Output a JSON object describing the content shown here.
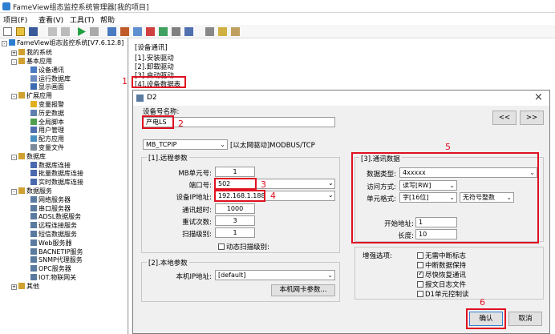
{
  "window": {
    "title": "FameView组态监控系统管理器[我的项目]"
  },
  "menu": [
    "项目(F)",
    "查看(V)",
    "工具(T)",
    "帮助"
  ],
  "tree": [
    {
      "label": "FameView组态监控系统[V7.6.12.8]",
      "level": 0,
      "expander": "-"
    },
    {
      "label": "我的系统",
      "level": 1,
      "expander": "+"
    },
    {
      "label": "基本应用",
      "level": 1,
      "expander": "-"
    },
    {
      "label": "设备通讯",
      "level": 2
    },
    {
      "label": "运行数据库",
      "level": 2
    },
    {
      "label": "显示画面",
      "level": 2
    },
    {
      "label": "扩展应用",
      "level": 1,
      "expander": "-"
    },
    {
      "label": "变量报警",
      "level": 2
    },
    {
      "label": "历史数据",
      "level": 2
    },
    {
      "label": "全局脚本",
      "level": 2
    },
    {
      "label": "用户管理",
      "level": 2
    },
    {
      "label": "配方应用",
      "level": 2
    },
    {
      "label": "变量文件",
      "level": 2
    },
    {
      "label": "数据库",
      "level": 1,
      "expander": "-"
    },
    {
      "label": "数据库连接",
      "level": 2
    },
    {
      "label": "批量数据库连接",
      "level": 2
    },
    {
      "label": "实时数据库连接",
      "level": 2
    },
    {
      "label": "数据服务",
      "level": 1,
      "expander": "-"
    },
    {
      "label": "网络服务器",
      "level": 2
    },
    {
      "label": "串口服务器",
      "level": 2
    },
    {
      "label": "ADSL数据服务",
      "level": 2
    },
    {
      "label": "远程连接服务",
      "level": 2
    },
    {
      "label": "短信数据服务",
      "level": 2
    },
    {
      "label": "Web服务器",
      "level": 2
    },
    {
      "label": "BACNETIP服务",
      "level": 2
    },
    {
      "label": "SNMP代理服务",
      "level": 2
    },
    {
      "label": "OPC服务器",
      "level": 2
    },
    {
      "label": "IOT.物联网关",
      "level": 2
    },
    {
      "label": "其他",
      "level": 1,
      "expander": "+"
    }
  ],
  "right": {
    "header": "[设备通讯]",
    "items": [
      "[1].安装驱动",
      "[2].卸载驱动",
      "[3].启动驱动",
      "[4].设备数据表"
    ]
  },
  "dialog": {
    "title": "D2",
    "device_label": "设备号名称:",
    "device_value": "产电LS",
    "prev_btn": "<<",
    "next_btn": ">>",
    "driver_select": "MB_TCPIP",
    "driver_desc": "[以太网驱动]MODBUS/TCP",
    "remote": {
      "title": "[1].远程参数",
      "fields": [
        {
          "label": "MB单元号:",
          "value": "1"
        },
        {
          "label": "端口号:",
          "value": "502"
        },
        {
          "label": "设备IP地址:",
          "value": "192.168.1.188"
        },
        {
          "label": "通讯超时:",
          "value": "1000"
        },
        {
          "label": "重试次数:",
          "value": "3"
        },
        {
          "label": "扫描级别:",
          "value": "1"
        }
      ],
      "dyn_scan": "动态扫描级别:"
    },
    "local": {
      "title": "[2].本地参数",
      "ip_label": "本机IP地址:",
      "ip_value": "[default]",
      "nic_btn": "本机网卡参数..."
    },
    "comm": {
      "title": "[3].通讯数据",
      "type_label": "数据类型:",
      "type_value": "4xxxxx",
      "access_label": "访问方式:",
      "access_value": "读写[RW]",
      "format_label": "单元格式:",
      "format_value": "字[16位]",
      "sign_value": "无符号整数",
      "start_label": "开始地址:",
      "start_value": "1",
      "len_label": "长度:",
      "len_value": "10"
    },
    "enhance": {
      "label": "增强选项:",
      "options": [
        {
          "label": "无需中断标志",
          "checked": false
        },
        {
          "label": "中断数据保持",
          "checked": false
        },
        {
          "label": "尽快恢复通讯",
          "checked": true
        },
        {
          "label": "报文日志文件",
          "checked": false
        },
        {
          "label": "D1单元控制读",
          "checked": false
        }
      ]
    },
    "ok_btn": "确认",
    "cancel_btn": "取消"
  },
  "markers": [
    "1",
    "2",
    "3",
    "4",
    "5",
    "6"
  ],
  "colors": {
    "highlight": "#e01020",
    "accent": "#2f7fd0"
  }
}
